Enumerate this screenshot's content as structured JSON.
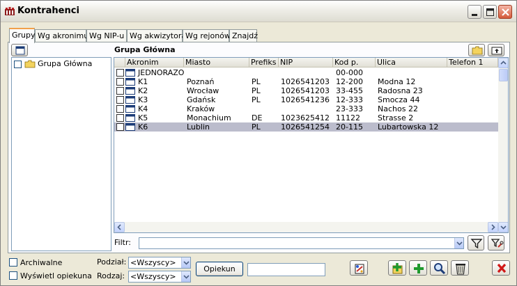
{
  "window": {
    "title": "Kontrahenci"
  },
  "tabs": [
    {
      "label": "Grupy",
      "active": true
    },
    {
      "label": "Wg akronimu"
    },
    {
      "label": "Wg NIP-u"
    },
    {
      "label": "Wg akwizytora"
    },
    {
      "label": "Wg rejonów"
    },
    {
      "label": "Znajdź"
    }
  ],
  "tree": {
    "root_label": "Grupa Główna"
  },
  "group_title": "Grupa Główna",
  "grid": {
    "columns": [
      "Akronim",
      "Miasto",
      "Prefiks",
      "NIP",
      "Kod p.",
      "Ulica",
      "Telefon 1"
    ],
    "rows": [
      {
        "akronim": "JEDNORAZOWY",
        "miasto": "",
        "prefiks": "",
        "nip": "",
        "kod": "00-000",
        "ulica": "",
        "telefon": ""
      },
      {
        "akronim": "K1",
        "miasto": "Poznań",
        "prefiks": "PL",
        "nip": "1026541203",
        "kod": "12-200",
        "ulica": "Modna 12",
        "telefon": ""
      },
      {
        "akronim": "K2",
        "miasto": "Wrocław",
        "prefiks": "PL",
        "nip": "1026541203",
        "kod": "33-455",
        "ulica": "Radosna 23",
        "telefon": ""
      },
      {
        "akronim": "K3",
        "miasto": "Gdańsk",
        "prefiks": "PL",
        "nip": "1026541236",
        "kod": "12-333",
        "ulica": "Smocza 44",
        "telefon": ""
      },
      {
        "akronim": "K4",
        "miasto": "Kraków",
        "prefiks": "",
        "nip": "",
        "kod": "23-333",
        "ulica": "Nachos 22",
        "telefon": ""
      },
      {
        "akronim": "K5",
        "miasto": "Monachium",
        "prefiks": "DE",
        "nip": "1023625412",
        "kod": "11122",
        "ulica": "Strasse 2",
        "telefon": ""
      },
      {
        "akronim": "K6",
        "miasto": "Lublin",
        "prefiks": "PL",
        "nip": "1026541254",
        "kod": "20-115",
        "ulica": "Lubartowska 12",
        "telefon": "",
        "selected": true
      }
    ]
  },
  "filter": {
    "label": "Filtr:",
    "value": ""
  },
  "bottom": {
    "archiwalne_label": "Archiwalne",
    "wyswietl_label": "Wyświetl opiekuna",
    "podzial_label": "Podział:",
    "podzial_value": "<Wszyscy>",
    "rodzaj_label": "Rodzaj:",
    "rodzaj_value": "<Wszyscy>",
    "opiekun_button": "Opiekun",
    "opiekun_value": ""
  },
  "colors": {
    "selected_row": "#bbbccc",
    "tab_accent": "#f1a04a",
    "window_bg": "#ece9d8"
  }
}
